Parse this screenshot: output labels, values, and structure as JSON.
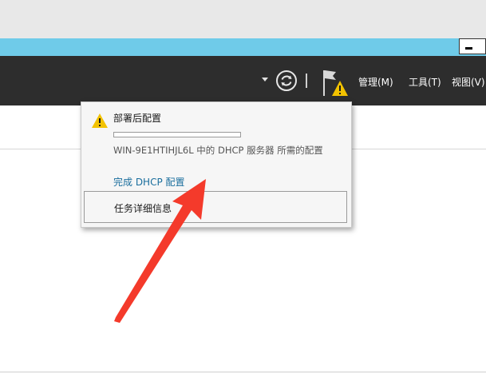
{
  "titlebar": {
    "minimize_icon": "minimize-icon"
  },
  "toolbar": {
    "refresh_icon": "refresh-icon",
    "notifications_icon": "flag-warning-icon",
    "menus": [
      "管理(M)",
      "工具(T)",
      "视图(V)"
    ]
  },
  "notification": {
    "title": "部署后配置",
    "progress": 0,
    "description": "WIN-9E1HTIHJL6L 中的 DHCP 服务器 所需的配置",
    "action_link": "完成 DHCP 配置",
    "details_label": "任务详细信息"
  },
  "annotation": {
    "arrow_color": "#f43a2b"
  },
  "colors": {
    "cyan_bar": "#6fcbe9",
    "dark_bar": "#2d2d2d",
    "link": "#1a6e9d",
    "warning": "#f2c200"
  }
}
